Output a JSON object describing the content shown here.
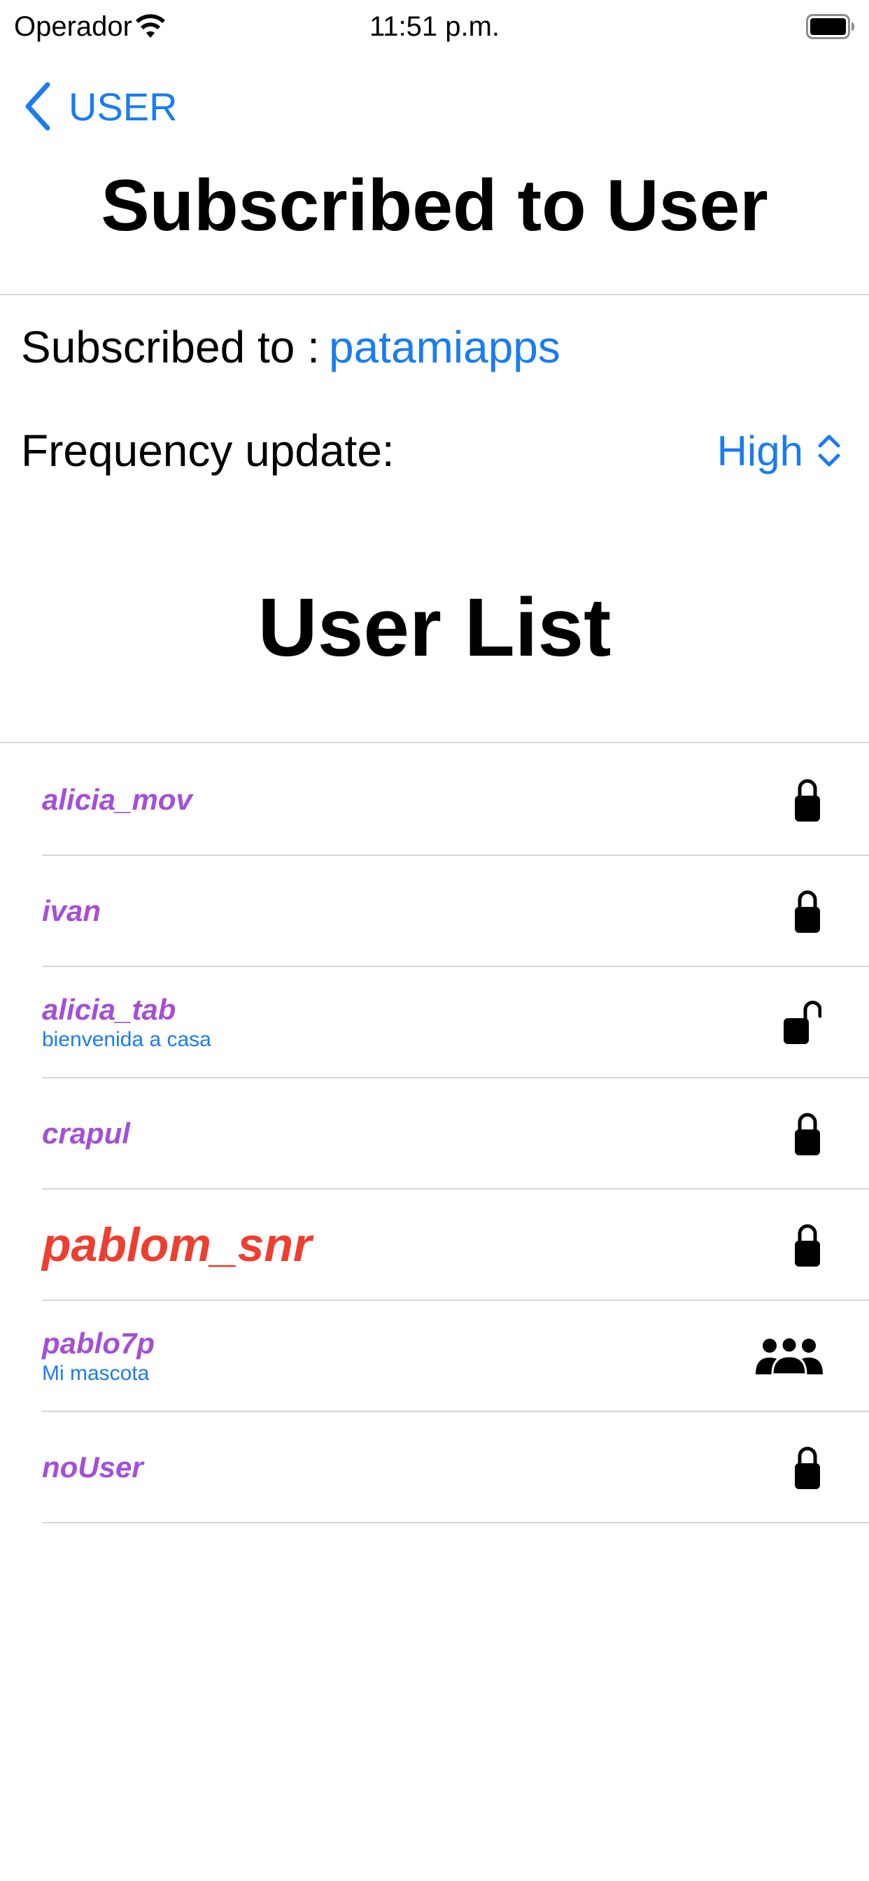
{
  "status_bar": {
    "carrier": "Operador",
    "time": "11:51 p.m."
  },
  "nav": {
    "back_label": "USER",
    "title": "Subscribed to User"
  },
  "subscription": {
    "subscribed_label": "Subscribed to :",
    "subscribed_value": "patamiapps",
    "frequency_label": "Frequency update:",
    "frequency_value": "High"
  },
  "user_list": {
    "title": "User List",
    "items": [
      {
        "name": "alicia_mov",
        "subtitle": "",
        "icon": "lock-icon"
      },
      {
        "name": "ivan",
        "subtitle": "",
        "icon": "lock-icon"
      },
      {
        "name": "alicia_tab",
        "subtitle": "bienvenida a casa",
        "icon": "unlock-icon"
      },
      {
        "name": "crapul",
        "subtitle": "",
        "icon": "lock-icon"
      },
      {
        "name": "pablom_snr",
        "subtitle": "",
        "icon": "lock-icon",
        "highlighted": true
      },
      {
        "name": "pablo7p",
        "subtitle": "Mi mascota",
        "icon": "group-icon"
      },
      {
        "name": "noUser",
        "subtitle": "",
        "icon": "lock-icon"
      }
    ]
  },
  "colors": {
    "accent": "#1a7cf0",
    "username": "#a44fd4",
    "highlight": "#ee3e2f",
    "divider": "#d6d6d6"
  }
}
